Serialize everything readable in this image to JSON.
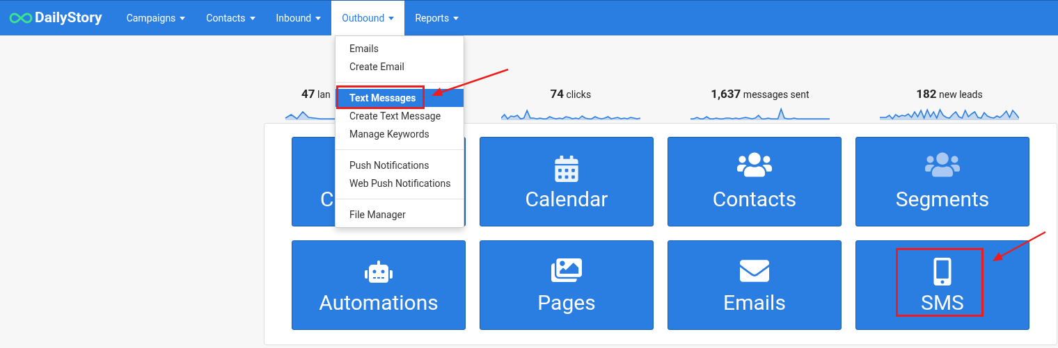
{
  "brand": {
    "name": "DailyStory"
  },
  "nav": [
    {
      "label": "Campaigns",
      "selected": false
    },
    {
      "label": "Contacts",
      "selected": false
    },
    {
      "label": "Inbound",
      "selected": false
    },
    {
      "label": "Outbound",
      "selected": true
    },
    {
      "label": "Reports",
      "selected": false
    }
  ],
  "dropdown": {
    "groups": [
      [
        {
          "label": "Emails",
          "selected": false
        },
        {
          "label": "Create Email",
          "selected": false
        }
      ],
      [
        {
          "label": "Text Messages",
          "selected": true
        },
        {
          "label": "Create Text Message",
          "selected": false
        },
        {
          "label": "Manage Keywords",
          "selected": false
        }
      ],
      [
        {
          "label": "Push Notifications",
          "selected": false
        },
        {
          "label": "Web Push Notifications",
          "selected": false
        }
      ],
      [
        {
          "label": "File Manager",
          "selected": false
        }
      ]
    ]
  },
  "stats": [
    {
      "value": "47",
      "label": "lan",
      "cut_off": true
    },
    {
      "value": "74",
      "label": "clicks",
      "cut_off": false
    },
    {
      "value": "1,637",
      "label": "messages sent",
      "cut_off": false
    },
    {
      "value": "182",
      "label": "new leads",
      "cut_off": false
    }
  ],
  "tiles": [
    {
      "kind": "campaigns",
      "label": "C",
      "cut_off": true
    },
    {
      "kind": "calendar",
      "label": "Calendar",
      "cut_off": false
    },
    {
      "kind": "contacts",
      "label": "Contacts",
      "cut_off": false
    },
    {
      "kind": "segments",
      "label": "Segments",
      "cut_off": false
    },
    {
      "kind": "automations",
      "label": "Automations",
      "cut_off": false
    },
    {
      "kind": "pages",
      "label": "Pages",
      "cut_off": false
    },
    {
      "kind": "emails",
      "label": "Emails",
      "cut_off": false
    },
    {
      "kind": "sms",
      "label": "SMS",
      "cut_off": false
    }
  ]
}
